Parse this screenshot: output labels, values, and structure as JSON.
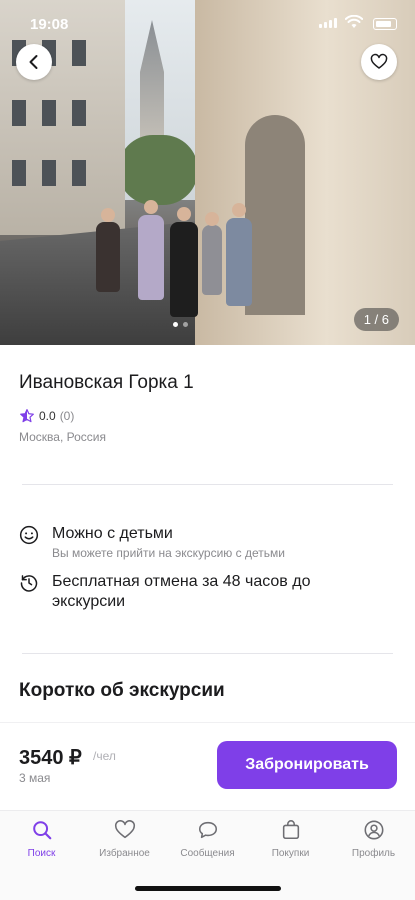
{
  "status": {
    "time": "19:08"
  },
  "gallery": {
    "counter": "1 / 6",
    "slide_index": 1,
    "slide_total": 6
  },
  "excursion": {
    "title": "Ивановская Горка 1",
    "rating": "0.0",
    "reviews": "(0)",
    "location": "Москва, Россия"
  },
  "features": [
    {
      "title": "Можно с детьми",
      "subtitle": "Вы можете прийти на экскурсию с детьми",
      "icon": "smiley-icon"
    },
    {
      "title": "Бесплатная отмена за 48 часов до экскурсии",
      "subtitle": "",
      "icon": "clock-history-icon"
    }
  ],
  "section": {
    "about_title": "Коротко об экскурсии"
  },
  "booking": {
    "price": "3540 ₽",
    "per": "/чел",
    "date": "3 мая",
    "button": "Забронировать"
  },
  "tabs": [
    {
      "label": "Поиск",
      "icon": "search-icon",
      "active": true
    },
    {
      "label": "Избранное",
      "icon": "heart-icon",
      "active": false
    },
    {
      "label": "Сообщения",
      "icon": "chat-icon",
      "active": false
    },
    {
      "label": "Покупки",
      "icon": "bag-icon",
      "active": false
    },
    {
      "label": "Профиль",
      "icon": "profile-icon",
      "active": false
    }
  ],
  "colors": {
    "accent": "#7f3fe8",
    "muted": "#8a8a8e"
  }
}
